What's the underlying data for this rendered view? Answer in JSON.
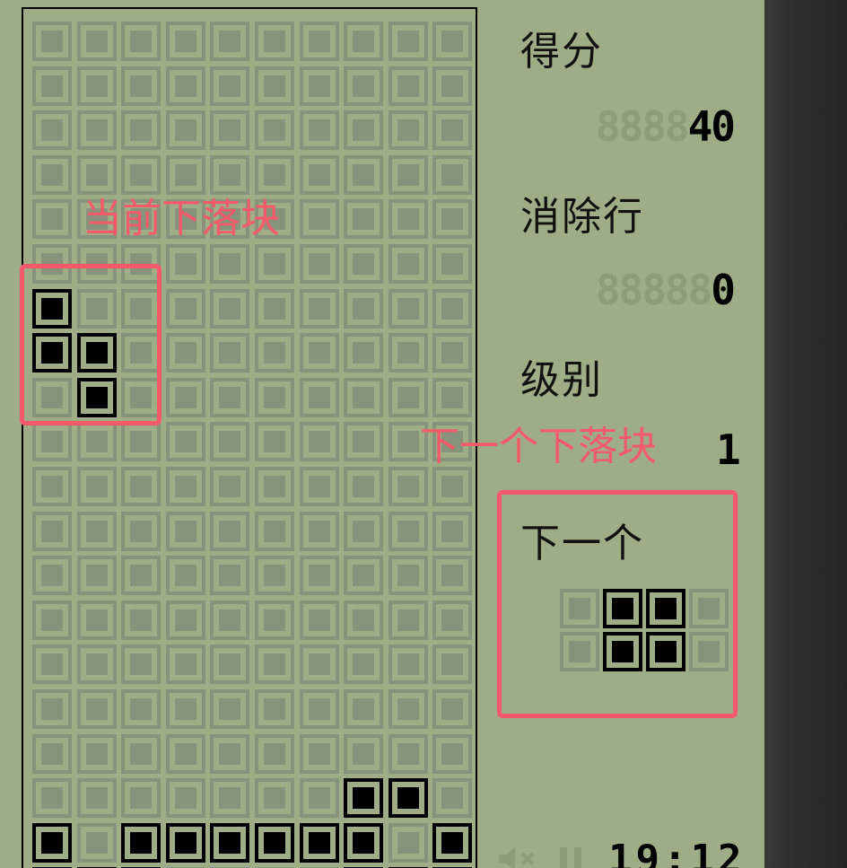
{
  "panel": {
    "score_label": "得分",
    "score_ghost": "8888",
    "score_value": "40",
    "lines_label": "消除行",
    "lines_ghost": "88888",
    "lines_value": "0",
    "level_label": "级别",
    "level_value": "1",
    "next_label": "下一个"
  },
  "annotations": {
    "current_piece": "当前下落块",
    "next_piece": "下一个下落块"
  },
  "board": {
    "columns": 10,
    "filled_cells": [
      [
        0,
        6
      ],
      [
        0,
        7
      ],
      [
        1,
        7
      ],
      [
        1,
        8
      ],
      [
        7,
        17
      ],
      [
        8,
        17
      ],
      [
        0,
        18
      ],
      [
        2,
        18
      ],
      [
        3,
        18
      ],
      [
        4,
        18
      ],
      [
        5,
        18
      ],
      [
        6,
        18
      ],
      [
        7,
        18
      ],
      [
        9,
        18
      ],
      [
        0,
        19
      ],
      [
        1,
        19
      ],
      [
        2,
        19
      ],
      [
        7,
        19
      ],
      [
        8,
        19
      ],
      [
        9,
        19
      ]
    ],
    "visible_rows": 20
  },
  "next_piece": {
    "shape": "O",
    "grid": [
      [
        0,
        1,
        1,
        0
      ],
      [
        0,
        1,
        1,
        0
      ]
    ]
  },
  "status": {
    "clock": "19:12",
    "sound_icon": "speaker-muted-icon",
    "pause_icon": "pause-icon"
  },
  "colors": {
    "screen": "#9ead86",
    "cell_off": "#87937a",
    "cell_on": "#000000",
    "annotation": "#f45a6a"
  }
}
